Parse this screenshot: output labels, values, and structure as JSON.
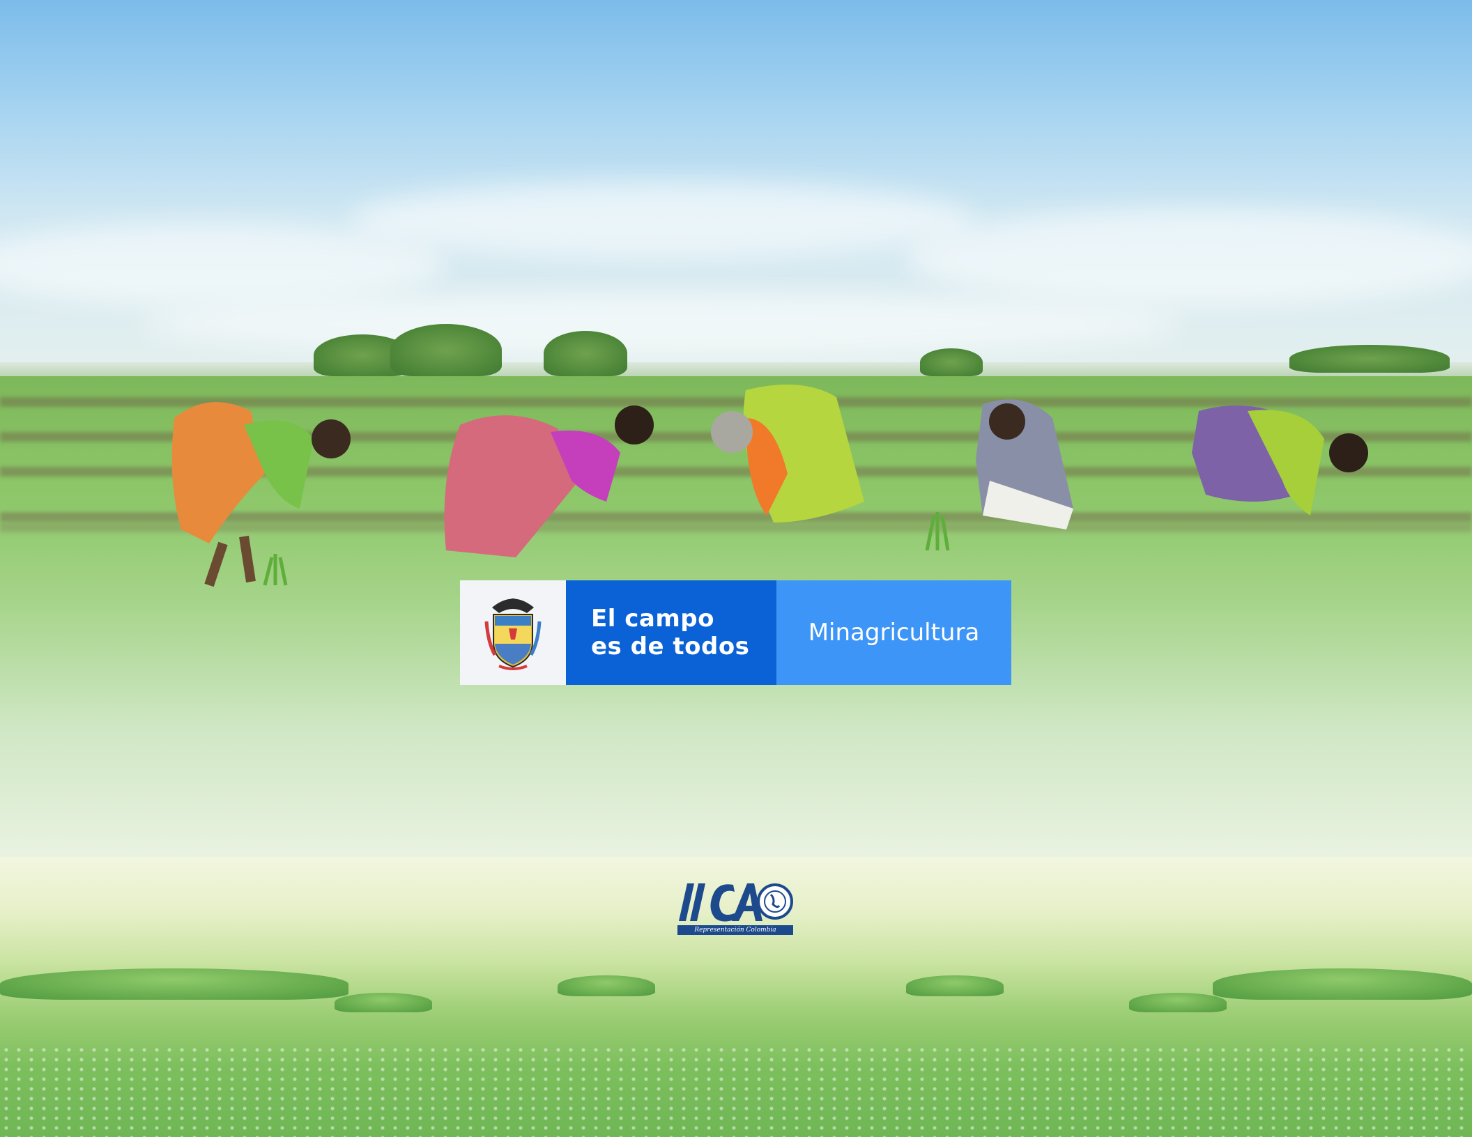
{
  "banner": {
    "slogan_line1": "El campo",
    "slogan_line2": "es de todos",
    "ministry": "Minagricultura",
    "colors": {
      "dark_blue": "#0b62d6",
      "light_blue": "#3d95f7",
      "shield_bg": "#f2f4f7"
    },
    "icon": "colombia-coat-of-arms-icon"
  },
  "iica": {
    "logo_text": "IICA",
    "caption": "Representación Colombia",
    "icon": "iica-emblem-icon",
    "color": "#1d4a8d"
  },
  "photo": {
    "icon": "rice-field-workers-photo"
  }
}
